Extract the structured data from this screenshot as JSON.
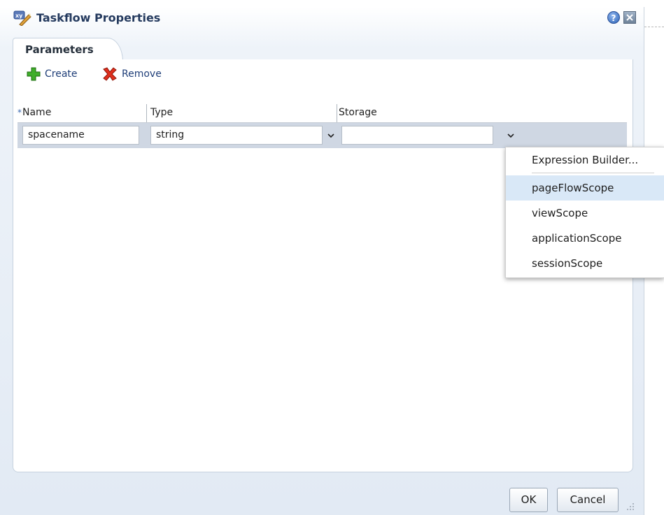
{
  "dialog": {
    "title": "Taskflow Properties",
    "title_icon": "xy-wand-icon",
    "help_icon_glyph": "?",
    "help_icon": "help-icon",
    "close_icon": "close-icon"
  },
  "tabs": [
    {
      "label": "Parameters",
      "selected": true
    }
  ],
  "toolbar": {
    "create_label": "Create",
    "create_icon": "plus-icon",
    "remove_label": "Remove",
    "remove_icon": "red-x-icon"
  },
  "table": {
    "required_marker": "*",
    "columns": [
      "Name",
      "Type",
      "Storage"
    ],
    "rows": [
      {
        "name": "spacename",
        "type": "string",
        "storage": ""
      }
    ]
  },
  "storage_menu": {
    "items": [
      {
        "label": "Expression Builder..."
      },
      {
        "label": "pageFlowScope",
        "highlighted": true
      },
      {
        "label": "viewScope"
      },
      {
        "label": "applicationScope"
      },
      {
        "label": "sessionScope"
      }
    ]
  },
  "footer": {
    "ok_label": "OK",
    "cancel_label": "Cancel"
  },
  "colors": {
    "title_text": "#243a5e",
    "link_text": "#1f3e78",
    "row_selected": "#cfd7e3",
    "menu_highlight": "#d9e8f7"
  }
}
